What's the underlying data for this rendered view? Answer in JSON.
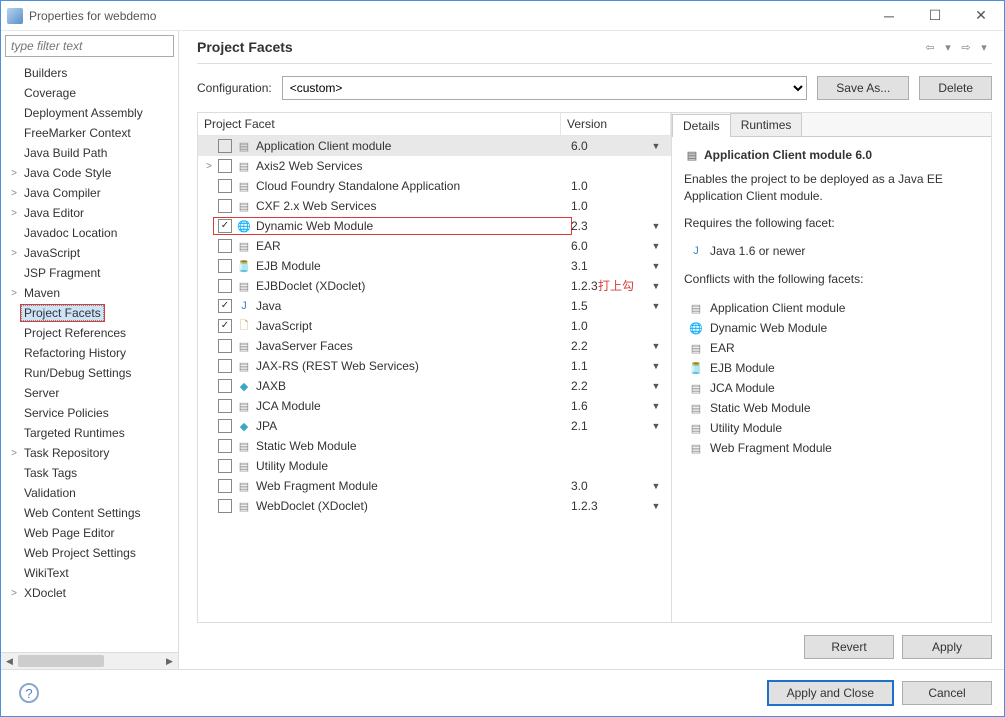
{
  "window": {
    "title": "Properties for webdemo",
    "filter_placeholder": "type filter text"
  },
  "sidebar": {
    "items": [
      {
        "label": "Builders",
        "expandable": false
      },
      {
        "label": "Coverage",
        "expandable": false
      },
      {
        "label": "Deployment Assembly",
        "expandable": false
      },
      {
        "label": "FreeMarker Context",
        "expandable": false
      },
      {
        "label": "Java Build Path",
        "expandable": false
      },
      {
        "label": "Java Code Style",
        "expandable": true
      },
      {
        "label": "Java Compiler",
        "expandable": true
      },
      {
        "label": "Java Editor",
        "expandable": true
      },
      {
        "label": "Javadoc Location",
        "expandable": false
      },
      {
        "label": "JavaScript",
        "expandable": true
      },
      {
        "label": "JSP Fragment",
        "expandable": false
      },
      {
        "label": "Maven",
        "expandable": true
      },
      {
        "label": "Project Facets",
        "expandable": false,
        "selected": true,
        "redbox": true
      },
      {
        "label": "Project References",
        "expandable": false
      },
      {
        "label": "Refactoring History",
        "expandable": false
      },
      {
        "label": "Run/Debug Settings",
        "expandable": false
      },
      {
        "label": "Server",
        "expandable": false
      },
      {
        "label": "Service Policies",
        "expandable": false
      },
      {
        "label": "Targeted Runtimes",
        "expandable": false
      },
      {
        "label": "Task Repository",
        "expandable": true
      },
      {
        "label": "Task Tags",
        "expandable": false
      },
      {
        "label": "Validation",
        "expandable": false
      },
      {
        "label": "Web Content Settings",
        "expandable": false
      },
      {
        "label": "Web Page Editor",
        "expandable": false
      },
      {
        "label": "Web Project Settings",
        "expandable": false
      },
      {
        "label": "WikiText",
        "expandable": false
      },
      {
        "label": "XDoclet",
        "expandable": true
      }
    ]
  },
  "page": {
    "title": "Project Facets",
    "config_label": "Configuration:",
    "config_value": "<custom>",
    "save_as": "Save As...",
    "delete": "Delete",
    "col_facet": "Project Facet",
    "col_version": "Version",
    "annotation": "打上勾"
  },
  "facets": [
    {
      "name": "Application Client module",
      "version": "6.0",
      "checked": false,
      "dd": true,
      "icon": "page",
      "selected": true
    },
    {
      "name": "Axis2 Web Services",
      "version": "",
      "checked": false,
      "dd": false,
      "icon": "page",
      "expandable": true
    },
    {
      "name": "Cloud Foundry Standalone Application",
      "version": "1.0",
      "checked": false,
      "dd": false,
      "icon": "page"
    },
    {
      "name": "CXF 2.x Web Services",
      "version": "1.0",
      "checked": false,
      "dd": false,
      "icon": "page"
    },
    {
      "name": "Dynamic Web Module",
      "version": "2.3",
      "checked": true,
      "dd": true,
      "icon": "globe",
      "hl": true
    },
    {
      "name": "EAR",
      "version": "6.0",
      "checked": false,
      "dd": true,
      "icon": "page"
    },
    {
      "name": "EJB Module",
      "version": "3.1",
      "checked": false,
      "dd": true,
      "icon": "jar"
    },
    {
      "name": "EJBDoclet (XDoclet)",
      "version": "1.2.3",
      "checked": false,
      "dd": true,
      "icon": "page"
    },
    {
      "name": "Java",
      "version": "1.5",
      "checked": true,
      "dd": true,
      "icon": "java"
    },
    {
      "name": "JavaScript",
      "version": "1.0",
      "checked": true,
      "dd": false,
      "icon": "js"
    },
    {
      "name": "JavaServer Faces",
      "version": "2.2",
      "checked": false,
      "dd": true,
      "icon": "page"
    },
    {
      "name": "JAX-RS (REST Web Services)",
      "version": "1.1",
      "checked": false,
      "dd": true,
      "icon": "page"
    },
    {
      "name": "JAXB",
      "version": "2.2",
      "checked": false,
      "dd": true,
      "icon": "diamond"
    },
    {
      "name": "JCA Module",
      "version": "1.6",
      "checked": false,
      "dd": true,
      "icon": "page"
    },
    {
      "name": "JPA",
      "version": "2.1",
      "checked": false,
      "dd": true,
      "icon": "diamond"
    },
    {
      "name": "Static Web Module",
      "version": "",
      "checked": false,
      "dd": false,
      "icon": "page"
    },
    {
      "name": "Utility Module",
      "version": "",
      "checked": false,
      "dd": false,
      "icon": "page"
    },
    {
      "name": "Web Fragment Module",
      "version": "3.0",
      "checked": false,
      "dd": true,
      "icon": "page"
    },
    {
      "name": "WebDoclet (XDoclet)",
      "version": "1.2.3",
      "checked": false,
      "dd": true,
      "icon": "page"
    }
  ],
  "details": {
    "tab_details": "Details",
    "tab_runtimes": "Runtimes",
    "title": "Application Client module 6.0",
    "desc": "Enables the project to be deployed as a Java EE Application Client module.",
    "requires_label": "Requires the following facet:",
    "requires": [
      {
        "label": "Java 1.6 or newer",
        "icon": "java"
      }
    ],
    "conflicts_label": "Conflicts with the following facets:",
    "conflicts": [
      {
        "label": "Application Client module",
        "icon": "page"
      },
      {
        "label": "Dynamic Web Module",
        "icon": "globe"
      },
      {
        "label": "EAR",
        "icon": "page"
      },
      {
        "label": "EJB Module",
        "icon": "jar"
      },
      {
        "label": "JCA Module",
        "icon": "page"
      },
      {
        "label": "Static Web Module",
        "icon": "page"
      },
      {
        "label": "Utility Module",
        "icon": "page"
      },
      {
        "label": "Web Fragment Module",
        "icon": "page"
      }
    ]
  },
  "buttons": {
    "revert": "Revert",
    "apply": "Apply",
    "apply_close": "Apply and Close",
    "cancel": "Cancel"
  }
}
